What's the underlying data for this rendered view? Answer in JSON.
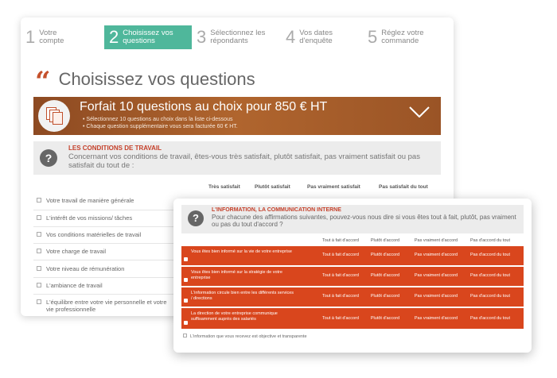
{
  "steps": [
    {
      "num": "1",
      "label": "Votre\ncompte"
    },
    {
      "num": "2",
      "label": "Choisissez vos\nquestions",
      "active": true
    },
    {
      "num": "3",
      "label": "Sélectionnez les\nrépondants"
    },
    {
      "num": "4",
      "label": "Vos dates\nd'enquête"
    },
    {
      "num": "5",
      "label": "Réglez votre\ncommande"
    }
  ],
  "page_title": "Choisissez vos questions",
  "banner": {
    "title": "Forfait 10 questions au choix pour 850 € HT",
    "bullets": [
      "Sélectionnez 10 questions au choix dans la liste ci-dessous",
      "Chaque question supplémentaire vous sera facturée 60 € HT."
    ]
  },
  "question1": {
    "title": "LES CONDITIONS DE TRAVAIL",
    "text": "Concernant vos conditions de travail, êtes-vous très satisfait, plutôt satisfait, pas vraiment satisfait ou pas satisfait du tout de :",
    "columns": [
      "Très satisfait",
      "Plutôt satisfait",
      "Pas vraiment satisfait",
      "Pas satisfait du tout"
    ],
    "rows": [
      "Votre travail de manière générale",
      "L'intérêt de vos missions/ tâches",
      "Vos conditions matérielles de travail",
      "Votre charge de travail",
      "Votre niveau de rémunération",
      "L'ambiance de travail",
      "L'équilibre entre votre vie personnelle et votre vie professionnelle"
    ]
  },
  "question2": {
    "title": "L'INFORMATION, LA COMMUNICATION INTERNE",
    "text": "Pour chacune des affirmations suivantes, pouvez-vous nous dire si vous êtes tout à fait, plutôt, pas vraiment ou pas du tout d'accord ?",
    "columns": [
      "Tout à fait d'accord",
      "Plutôt d'accord",
      "Pas vraiment d'accord",
      "Pas d'accord du tout"
    ],
    "rows": [
      "Vous êtes bien informé sur la vie de votre entreprise",
      "Vous êtes bien informé sur la stratégie de votre entreprise",
      "L'information circule bien entre les différents services / directions",
      "La direction de votre entreprise communique suffisamment auprès des salariés"
    ],
    "last_row": "L'information que vous recevez est objective et transparente"
  },
  "colors": {
    "accent_green": "#4fb79b",
    "accent_orange": "#d9461d",
    "title_red": "#c5402a"
  }
}
